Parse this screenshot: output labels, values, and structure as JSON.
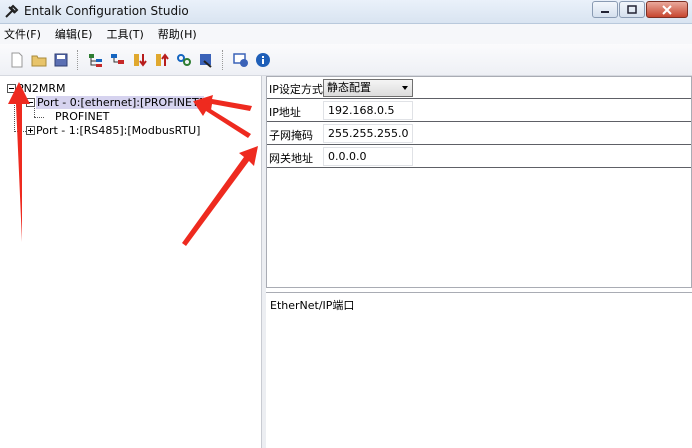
{
  "window": {
    "title": "Entalk Configuration Studio"
  },
  "menu": [
    {
      "label": "文件(F)"
    },
    {
      "label": "编辑(E)"
    },
    {
      "label": "工具(T)"
    },
    {
      "label": "帮助(H)"
    }
  ],
  "toolbar": {
    "icons": [
      "new-file-icon",
      "open-folder-icon",
      "save-icon",
      "tree-add-icon",
      "tree-edit-icon",
      "download-icon",
      "upload-icon",
      "link-icon",
      "tool-icon",
      "monitor-icon",
      "info-icon"
    ]
  },
  "tree": {
    "root": "PN2MRM",
    "port0": "Port - 0:[ethernet]:[PROFINET]",
    "port0_child": "PROFINET",
    "port1": "Port - 1:[RS485]:[ModbusRTU]"
  },
  "properties": {
    "ip_mode_label": "IP设定方式",
    "ip_mode_value": "静态配置",
    "ip_label": "IP地址",
    "ip_value": "192.168.0.5",
    "mask_label": "子网掩码",
    "mask_value": "255.255.255.0",
    "gateway_label": "网关地址",
    "gateway_value": "0.0.0.0"
  },
  "description": {
    "text": "EtherNet/IP端口"
  },
  "colors": {
    "arrow": "#ee2a1f",
    "selection": "#d6d3ef"
  }
}
